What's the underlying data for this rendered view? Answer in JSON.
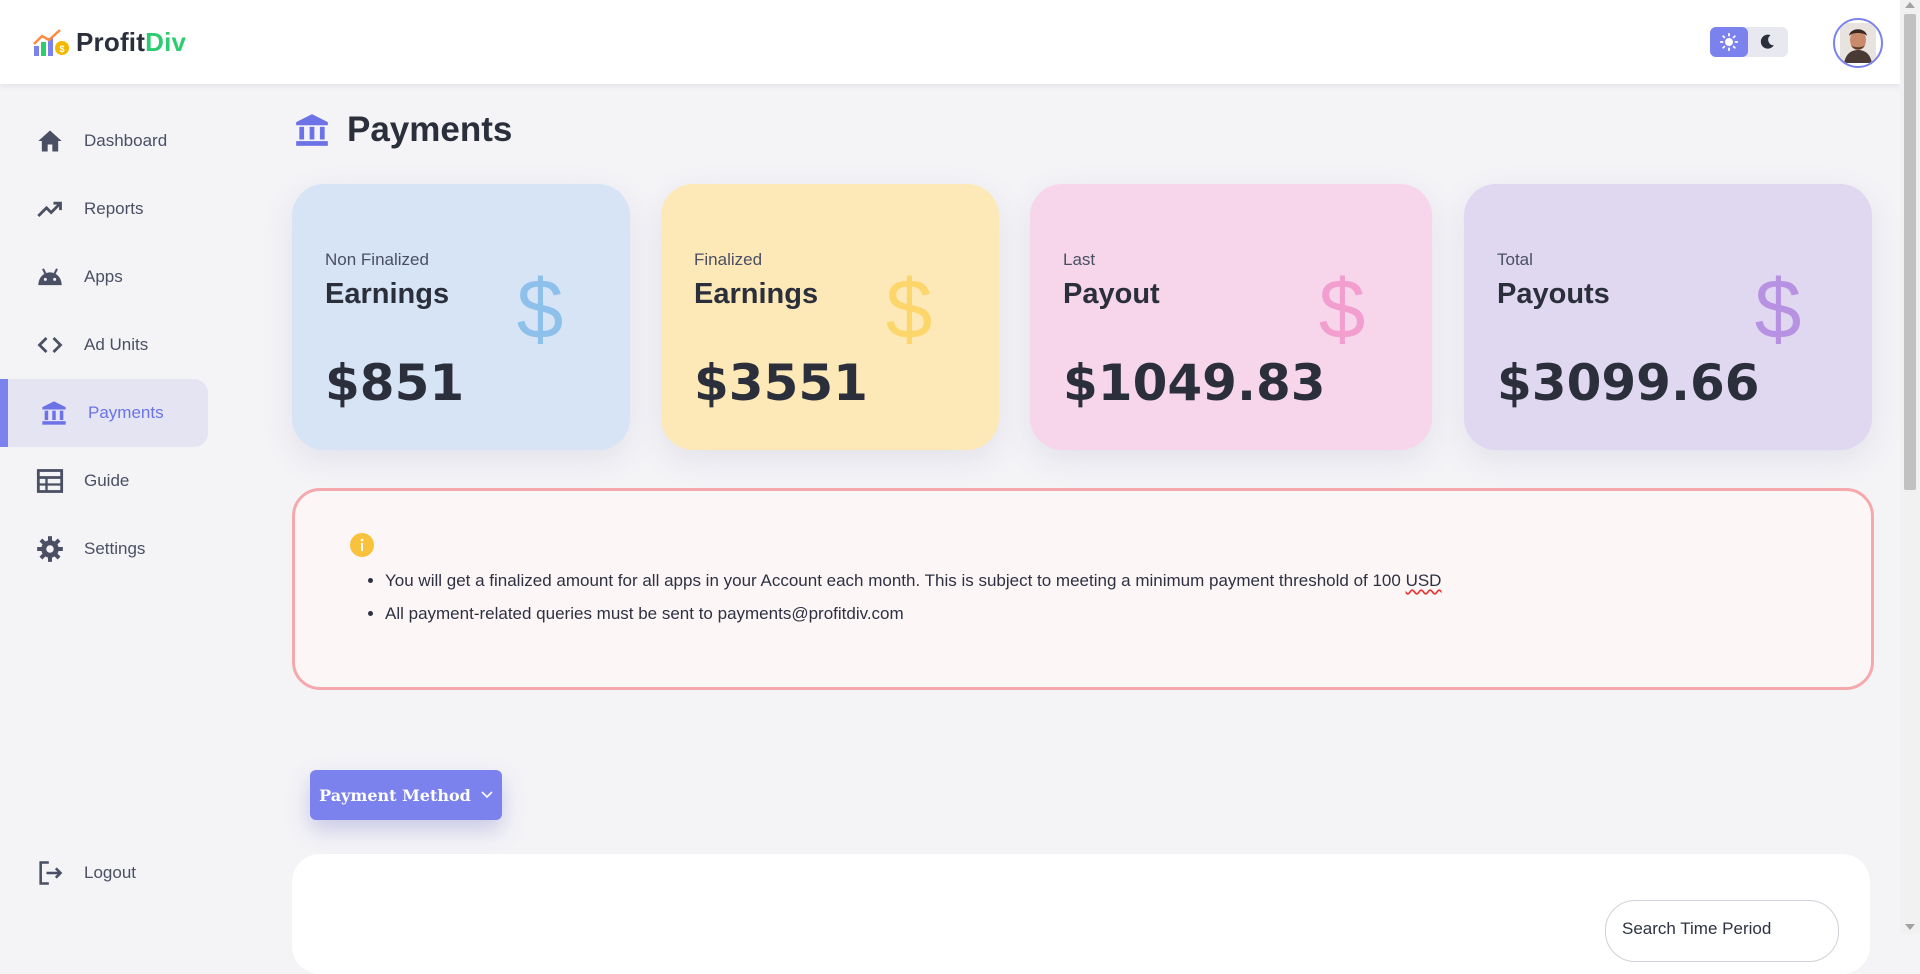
{
  "app": {
    "logo_part1": "Profit",
    "logo_part2": "Div",
    "accent_color": "#7b82ee",
    "brand_green": "#2ecc71"
  },
  "header": {
    "theme_light_icon": "sun-icon",
    "theme_dark_icon": "moon-icon",
    "avatar_icon": "avatar"
  },
  "sidebar": {
    "items": [
      {
        "label": "Dashboard",
        "icon": "home-icon"
      },
      {
        "label": "Reports",
        "icon": "trending-up-icon"
      },
      {
        "label": "Apps",
        "icon": "android-icon"
      },
      {
        "label": "Ad Units",
        "icon": "code-icon"
      },
      {
        "label": "Payments",
        "icon": "bank-icon",
        "active": true
      },
      {
        "label": "Guide",
        "icon": "table-icon"
      },
      {
        "label": "Settings",
        "icon": "gear-icon"
      }
    ],
    "logout": {
      "label": "Logout",
      "icon": "logout-icon"
    }
  },
  "page": {
    "title": "Payments",
    "title_icon": "bank-icon"
  },
  "cards": [
    {
      "subtitle": "Non Finalized",
      "title": "Earnings",
      "amount": "$851",
      "bg": "#d6e4f5",
      "icon_color": "#8ec0ec"
    },
    {
      "subtitle": "Finalized",
      "title": "Earnings",
      "amount": "$3551",
      "bg": "#fde9b7",
      "icon_color": "#fcd56b"
    },
    {
      "subtitle": "Last",
      "title": "Payout",
      "amount": "$1049.83",
      "bg": "#f7d6ec",
      "icon_color": "#f29fd0"
    },
    {
      "subtitle": "Total",
      "title": "Payouts",
      "amount": "$3099.66",
      "bg": "#e0d7f0",
      "icon_color": "#b791e2"
    }
  ],
  "notice": {
    "line1_prefix": "You will get a finalized amount for all apps in your Account each month. This is subject to meeting a minimum payment threshold of 100 ",
    "line1_unit": "USD",
    "line2": "All payment-related queries must be sent to payments@profitdiv.com",
    "border_color": "#f5a9ad"
  },
  "payment_method": {
    "label": "Payment Method"
  },
  "filter": {
    "search_period_placeholder": "Search Time Period"
  }
}
